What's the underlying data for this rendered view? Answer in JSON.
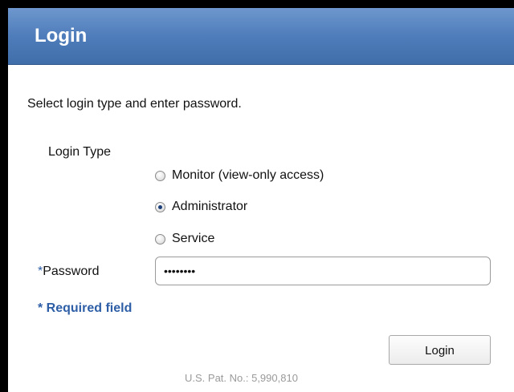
{
  "dialog": {
    "title": "Login"
  },
  "instructions": "Select login type and enter password.",
  "login_type": {
    "label": "Login Type",
    "options": [
      {
        "label": "Monitor (view-only access)",
        "checked": false
      },
      {
        "label": "Administrator",
        "checked": true
      },
      {
        "label": "Service",
        "checked": false
      }
    ]
  },
  "password": {
    "label_star": "*",
    "label": "Password",
    "value": "••••••••"
  },
  "required_note": "* Required field",
  "buttons": {
    "login_label": "Login"
  },
  "footer": {
    "patent": "U.S. Pat. No.: 5,990,810"
  },
  "colors": {
    "title_bar": "#4f7dbb",
    "accent_text": "#2d5ea6"
  }
}
